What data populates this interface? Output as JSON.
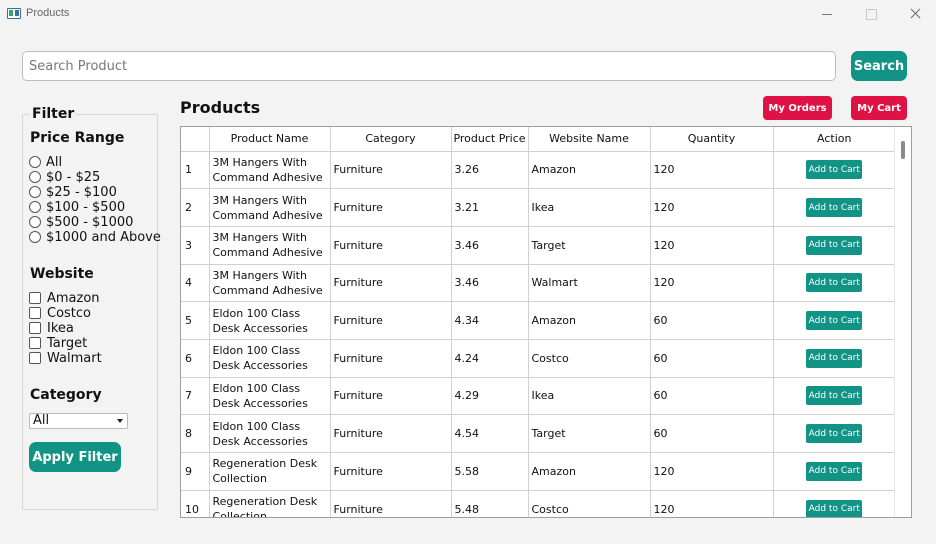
{
  "window": {
    "title": "Products"
  },
  "search": {
    "placeholder": "Search Product",
    "button": "Search"
  },
  "filter": {
    "title": "Filter",
    "price_range": {
      "heading": "Price Range",
      "options": [
        "All",
        "$0 - $25",
        "$25 - $100",
        "$100 - $500",
        "$500 - $1000",
        "$1000 and Above"
      ]
    },
    "website": {
      "heading": "Website",
      "options": [
        "Amazon",
        "Costco",
        "Ikea",
        "Target",
        "Walmart"
      ]
    },
    "category": {
      "heading": "Category",
      "selected": "All"
    },
    "apply_button": "Apply Filter"
  },
  "products": {
    "title": "Products",
    "my_orders": "My Orders",
    "my_cart": "My Cart",
    "columns": [
      "Product Name",
      "Category",
      "Product Price",
      "Website Name",
      "Quantity",
      "Action"
    ],
    "rows": [
      {
        "idx": "1",
        "name": "3M Hangers With Command Adhesive",
        "category": "Furniture",
        "price": "3.26",
        "website": "Amazon",
        "quantity": "120",
        "action": "Add to Cart"
      },
      {
        "idx": "2",
        "name": "3M Hangers With Command Adhesive",
        "category": "Furniture",
        "price": "3.21",
        "website": "Ikea",
        "quantity": "120",
        "action": "Add to Cart"
      },
      {
        "idx": "3",
        "name": "3M Hangers With Command Adhesive",
        "category": "Furniture",
        "price": "3.46",
        "website": "Target",
        "quantity": "120",
        "action": "Add to Cart"
      },
      {
        "idx": "4",
        "name": "3M Hangers With Command Adhesive",
        "category": "Furniture",
        "price": "3.46",
        "website": "Walmart",
        "quantity": "120",
        "action": "Add to Cart"
      },
      {
        "idx": "5",
        "name": "Eldon 100 Class Desk Accessories",
        "category": "Furniture",
        "price": "4.34",
        "website": "Amazon",
        "quantity": "60",
        "action": "Add to Cart"
      },
      {
        "idx": "6",
        "name": "Eldon 100 Class Desk Accessories",
        "category": "Furniture",
        "price": "4.24",
        "website": "Costco",
        "quantity": "60",
        "action": "Add to Cart"
      },
      {
        "idx": "7",
        "name": "Eldon 100 Class Desk Accessories",
        "category": "Furniture",
        "price": "4.29",
        "website": "Ikea",
        "quantity": "60",
        "action": "Add to Cart"
      },
      {
        "idx": "8",
        "name": "Eldon 100 Class Desk Accessories",
        "category": "Furniture",
        "price": "4.54",
        "website": "Target",
        "quantity": "60",
        "action": "Add to Cart"
      },
      {
        "idx": "9",
        "name": "Regeneration Desk Collection",
        "category": "Furniture",
        "price": "5.58",
        "website": "Amazon",
        "quantity": "120",
        "action": "Add to Cart"
      },
      {
        "idx": "10",
        "name": "Regeneration Desk Collection",
        "category": "Furniture",
        "price": "5.48",
        "website": "Costco",
        "quantity": "120",
        "action": "Add to Cart"
      }
    ]
  },
  "colors": {
    "primary": "#119485",
    "accent": "#de1245"
  }
}
